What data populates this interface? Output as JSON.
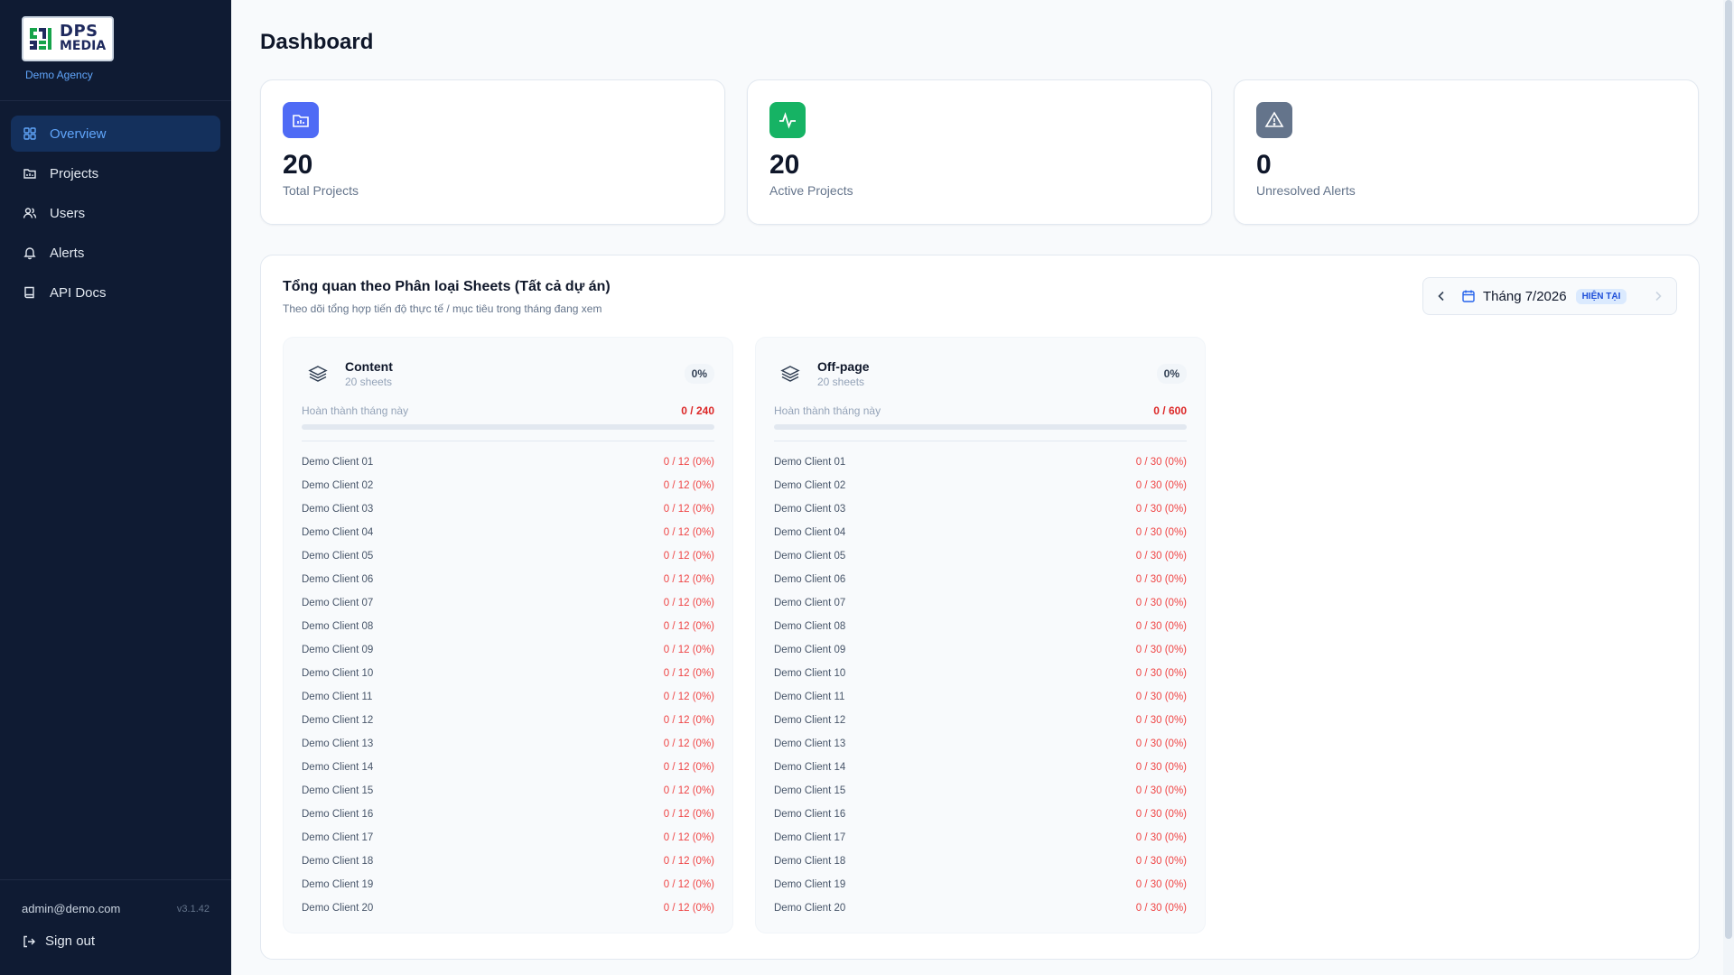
{
  "brand": {
    "logo_line1": "DPS",
    "logo_line2": "MEDIA",
    "agency": "Demo Agency"
  },
  "sidebar": {
    "items": [
      {
        "label": "Overview",
        "icon": "grid-icon",
        "active": true
      },
      {
        "label": "Projects",
        "icon": "folder-icon",
        "active": false
      },
      {
        "label": "Users",
        "icon": "users-icon",
        "active": false
      },
      {
        "label": "Alerts",
        "icon": "bell-icon",
        "active": false
      },
      {
        "label": "API Docs",
        "icon": "book-icon",
        "active": false
      }
    ],
    "user_email": "admin@demo.com",
    "version": "v3.1.42",
    "signout_label": "Sign out"
  },
  "header": {
    "title": "Dashboard"
  },
  "stats": [
    {
      "value": "20",
      "label": "Total Projects",
      "icon": "folder-chart-icon",
      "color": "#4f6bf5"
    },
    {
      "value": "20",
      "label": "Active Projects",
      "icon": "activity-icon",
      "color": "#16b364"
    },
    {
      "value": "0",
      "label": "Unresolved Alerts",
      "icon": "warning-icon",
      "color": "#64748b"
    }
  ],
  "overview": {
    "title": "Tổng quan theo Phân loại Sheets (Tất cả dự án)",
    "subtitle": "Theo dõi tổng hợp tiến độ thực tế / mục tiêu trong tháng đang xem",
    "month_label": "Tháng 7/2026",
    "current_badge": "HIỆN TẠI"
  },
  "categories": [
    {
      "name": "Content",
      "count": "20 sheets",
      "percent": "0%",
      "progress_label": "Hoàn thành tháng này",
      "progress_value": "0 / 240",
      "progress_fraction": 0,
      "clients": [
        {
          "name": "Demo Client 01",
          "value": "0 / 12 (0%)"
        },
        {
          "name": "Demo Client 02",
          "value": "0 / 12 (0%)"
        },
        {
          "name": "Demo Client 03",
          "value": "0 / 12 (0%)"
        },
        {
          "name": "Demo Client 04",
          "value": "0 / 12 (0%)"
        },
        {
          "name": "Demo Client 05",
          "value": "0 / 12 (0%)"
        },
        {
          "name": "Demo Client 06",
          "value": "0 / 12 (0%)"
        },
        {
          "name": "Demo Client 07",
          "value": "0 / 12 (0%)"
        },
        {
          "name": "Demo Client 08",
          "value": "0 / 12 (0%)"
        },
        {
          "name": "Demo Client 09",
          "value": "0 / 12 (0%)"
        },
        {
          "name": "Demo Client 10",
          "value": "0 / 12 (0%)"
        },
        {
          "name": "Demo Client 11",
          "value": "0 / 12 (0%)"
        },
        {
          "name": "Demo Client 12",
          "value": "0 / 12 (0%)"
        },
        {
          "name": "Demo Client 13",
          "value": "0 / 12 (0%)"
        },
        {
          "name": "Demo Client 14",
          "value": "0 / 12 (0%)"
        },
        {
          "name": "Demo Client 15",
          "value": "0 / 12 (0%)"
        },
        {
          "name": "Demo Client 16",
          "value": "0 / 12 (0%)"
        },
        {
          "name": "Demo Client 17",
          "value": "0 / 12 (0%)"
        },
        {
          "name": "Demo Client 18",
          "value": "0 / 12 (0%)"
        },
        {
          "name": "Demo Client 19",
          "value": "0 / 12 (0%)"
        },
        {
          "name": "Demo Client 20",
          "value": "0 / 12 (0%)"
        }
      ]
    },
    {
      "name": "Off-page",
      "count": "20 sheets",
      "percent": "0%",
      "progress_label": "Hoàn thành tháng này",
      "progress_value": "0 / 600",
      "progress_fraction": 0,
      "clients": [
        {
          "name": "Demo Client 01",
          "value": "0 / 30 (0%)"
        },
        {
          "name": "Demo Client 02",
          "value": "0 / 30 (0%)"
        },
        {
          "name": "Demo Client 03",
          "value": "0 / 30 (0%)"
        },
        {
          "name": "Demo Client 04",
          "value": "0 / 30 (0%)"
        },
        {
          "name": "Demo Client 05",
          "value": "0 / 30 (0%)"
        },
        {
          "name": "Demo Client 06",
          "value": "0 / 30 (0%)"
        },
        {
          "name": "Demo Client 07",
          "value": "0 / 30 (0%)"
        },
        {
          "name": "Demo Client 08",
          "value": "0 / 30 (0%)"
        },
        {
          "name": "Demo Client 09",
          "value": "0 / 30 (0%)"
        },
        {
          "name": "Demo Client 10",
          "value": "0 / 30 (0%)"
        },
        {
          "name": "Demo Client 11",
          "value": "0 / 30 (0%)"
        },
        {
          "name": "Demo Client 12",
          "value": "0 / 30 (0%)"
        },
        {
          "name": "Demo Client 13",
          "value": "0 / 30 (0%)"
        },
        {
          "name": "Demo Client 14",
          "value": "0 / 30 (0%)"
        },
        {
          "name": "Demo Client 15",
          "value": "0 / 30 (0%)"
        },
        {
          "name": "Demo Client 16",
          "value": "0 / 30 (0%)"
        },
        {
          "name": "Demo Client 17",
          "value": "0 / 30 (0%)"
        },
        {
          "name": "Demo Client 18",
          "value": "0 / 30 (0%)"
        },
        {
          "name": "Demo Client 19",
          "value": "0 / 30 (0%)"
        },
        {
          "name": "Demo Client 20",
          "value": "0 / 30 (0%)"
        }
      ]
    }
  ]
}
